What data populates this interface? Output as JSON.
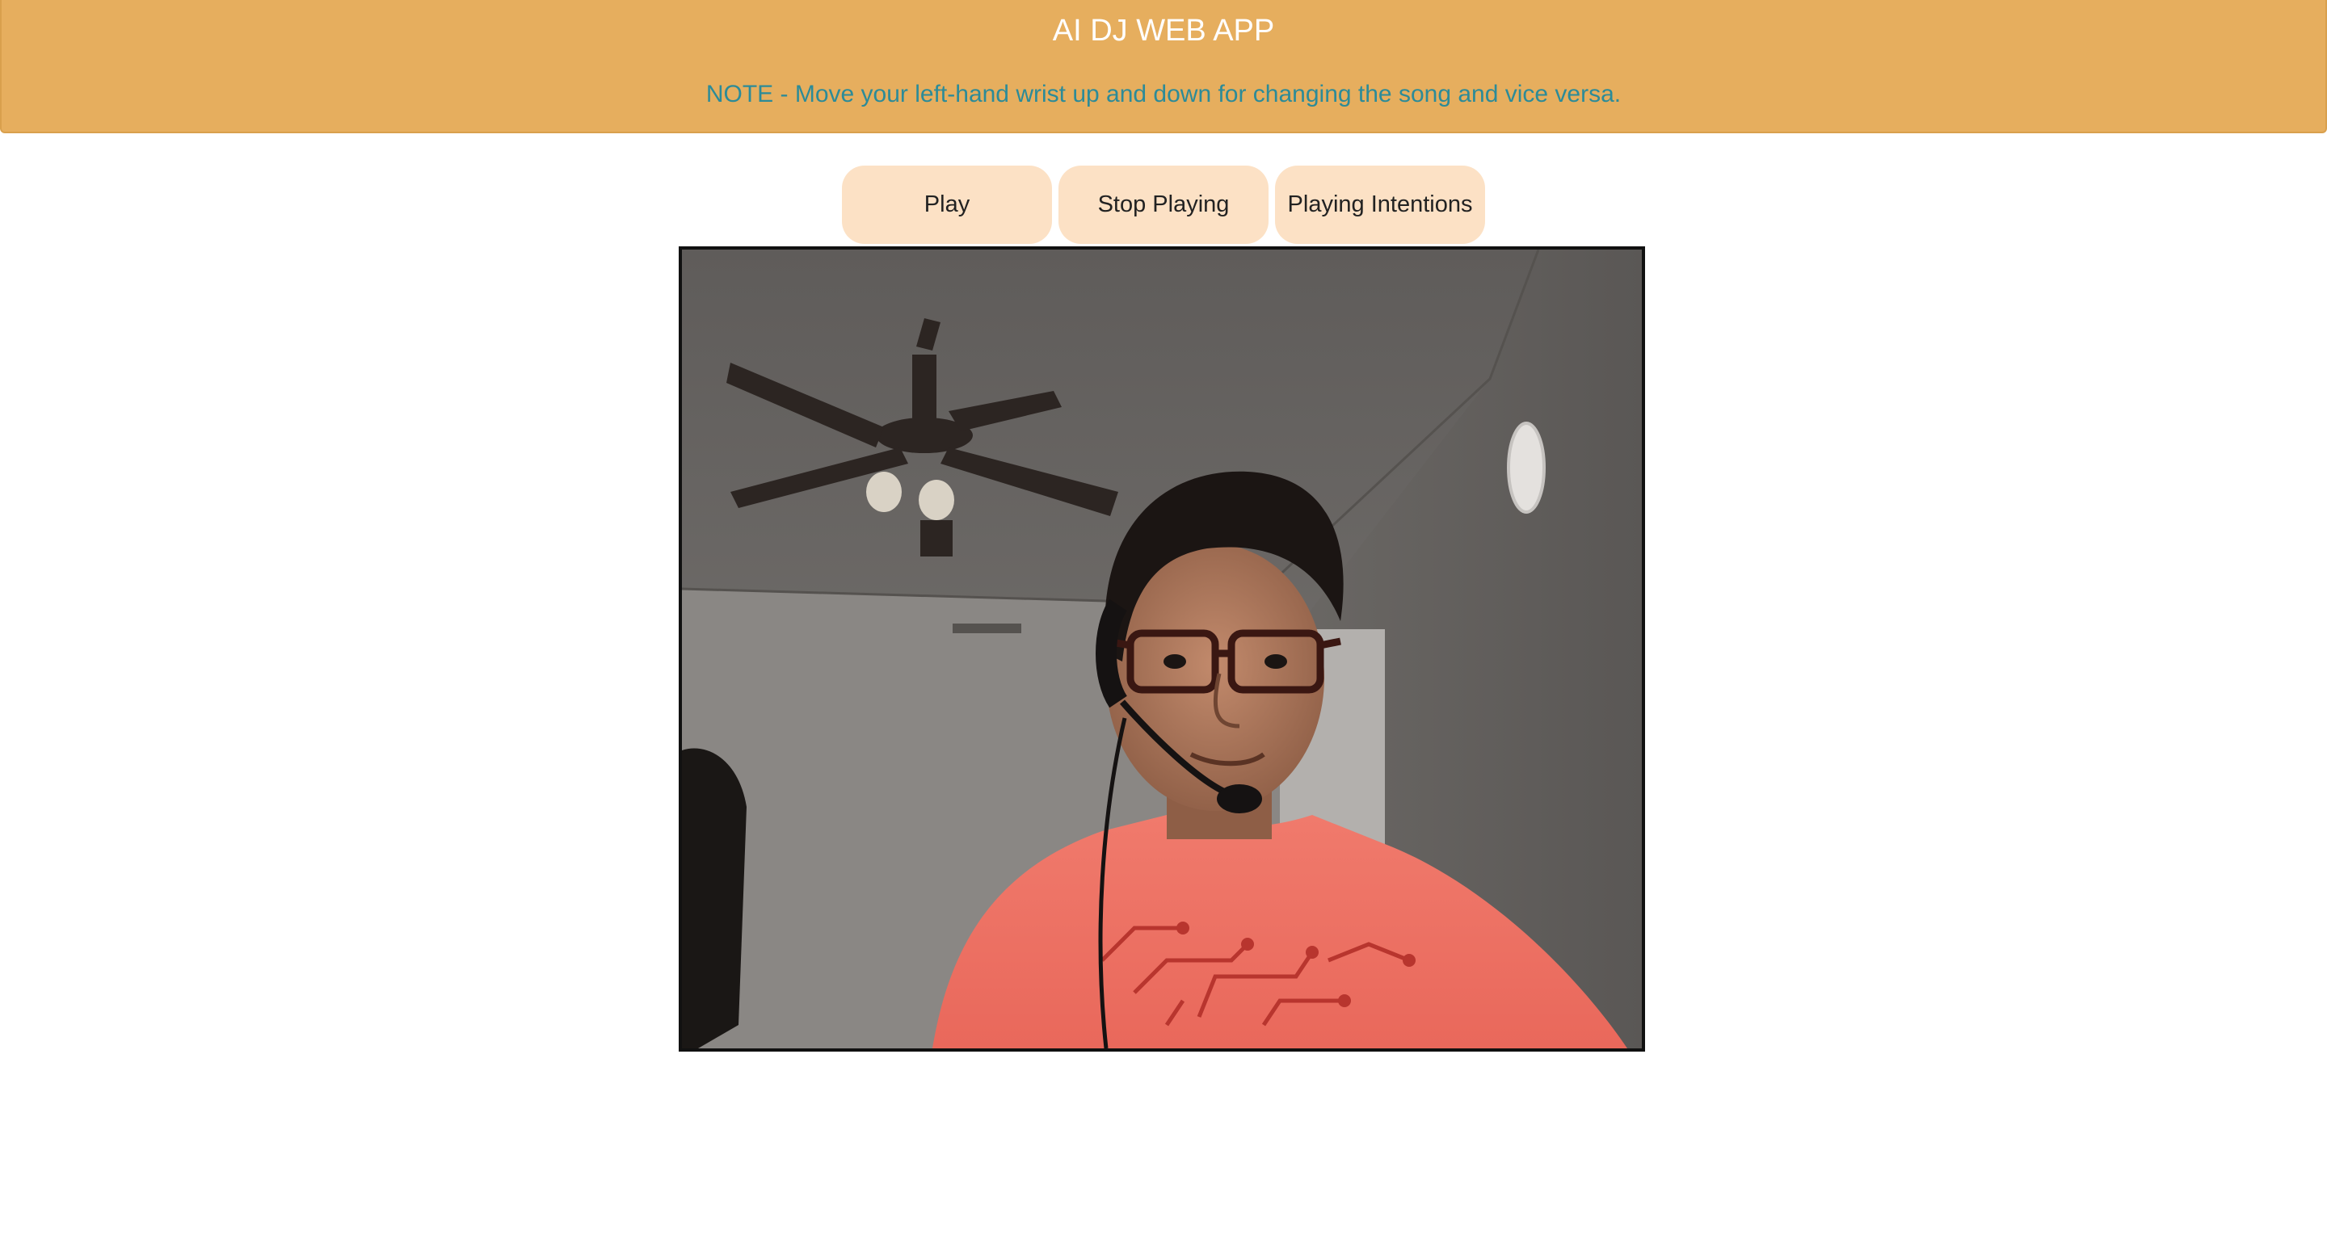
{
  "header": {
    "title": "AI DJ WEB APP",
    "note": "NOTE - Move your left-hand wrist up and down for changing the song and vice versa."
  },
  "controls": {
    "play_label": "Play",
    "stop_label": "Stop Playing",
    "intentions_label": "Playing Intentions"
  },
  "colors": {
    "header_bg": "#e6ae5e",
    "title_text": "#ffffff",
    "note_text": "#2c8b98",
    "button_bg": "#fce1c5"
  },
  "video": {
    "content": "webcam-feed"
  }
}
